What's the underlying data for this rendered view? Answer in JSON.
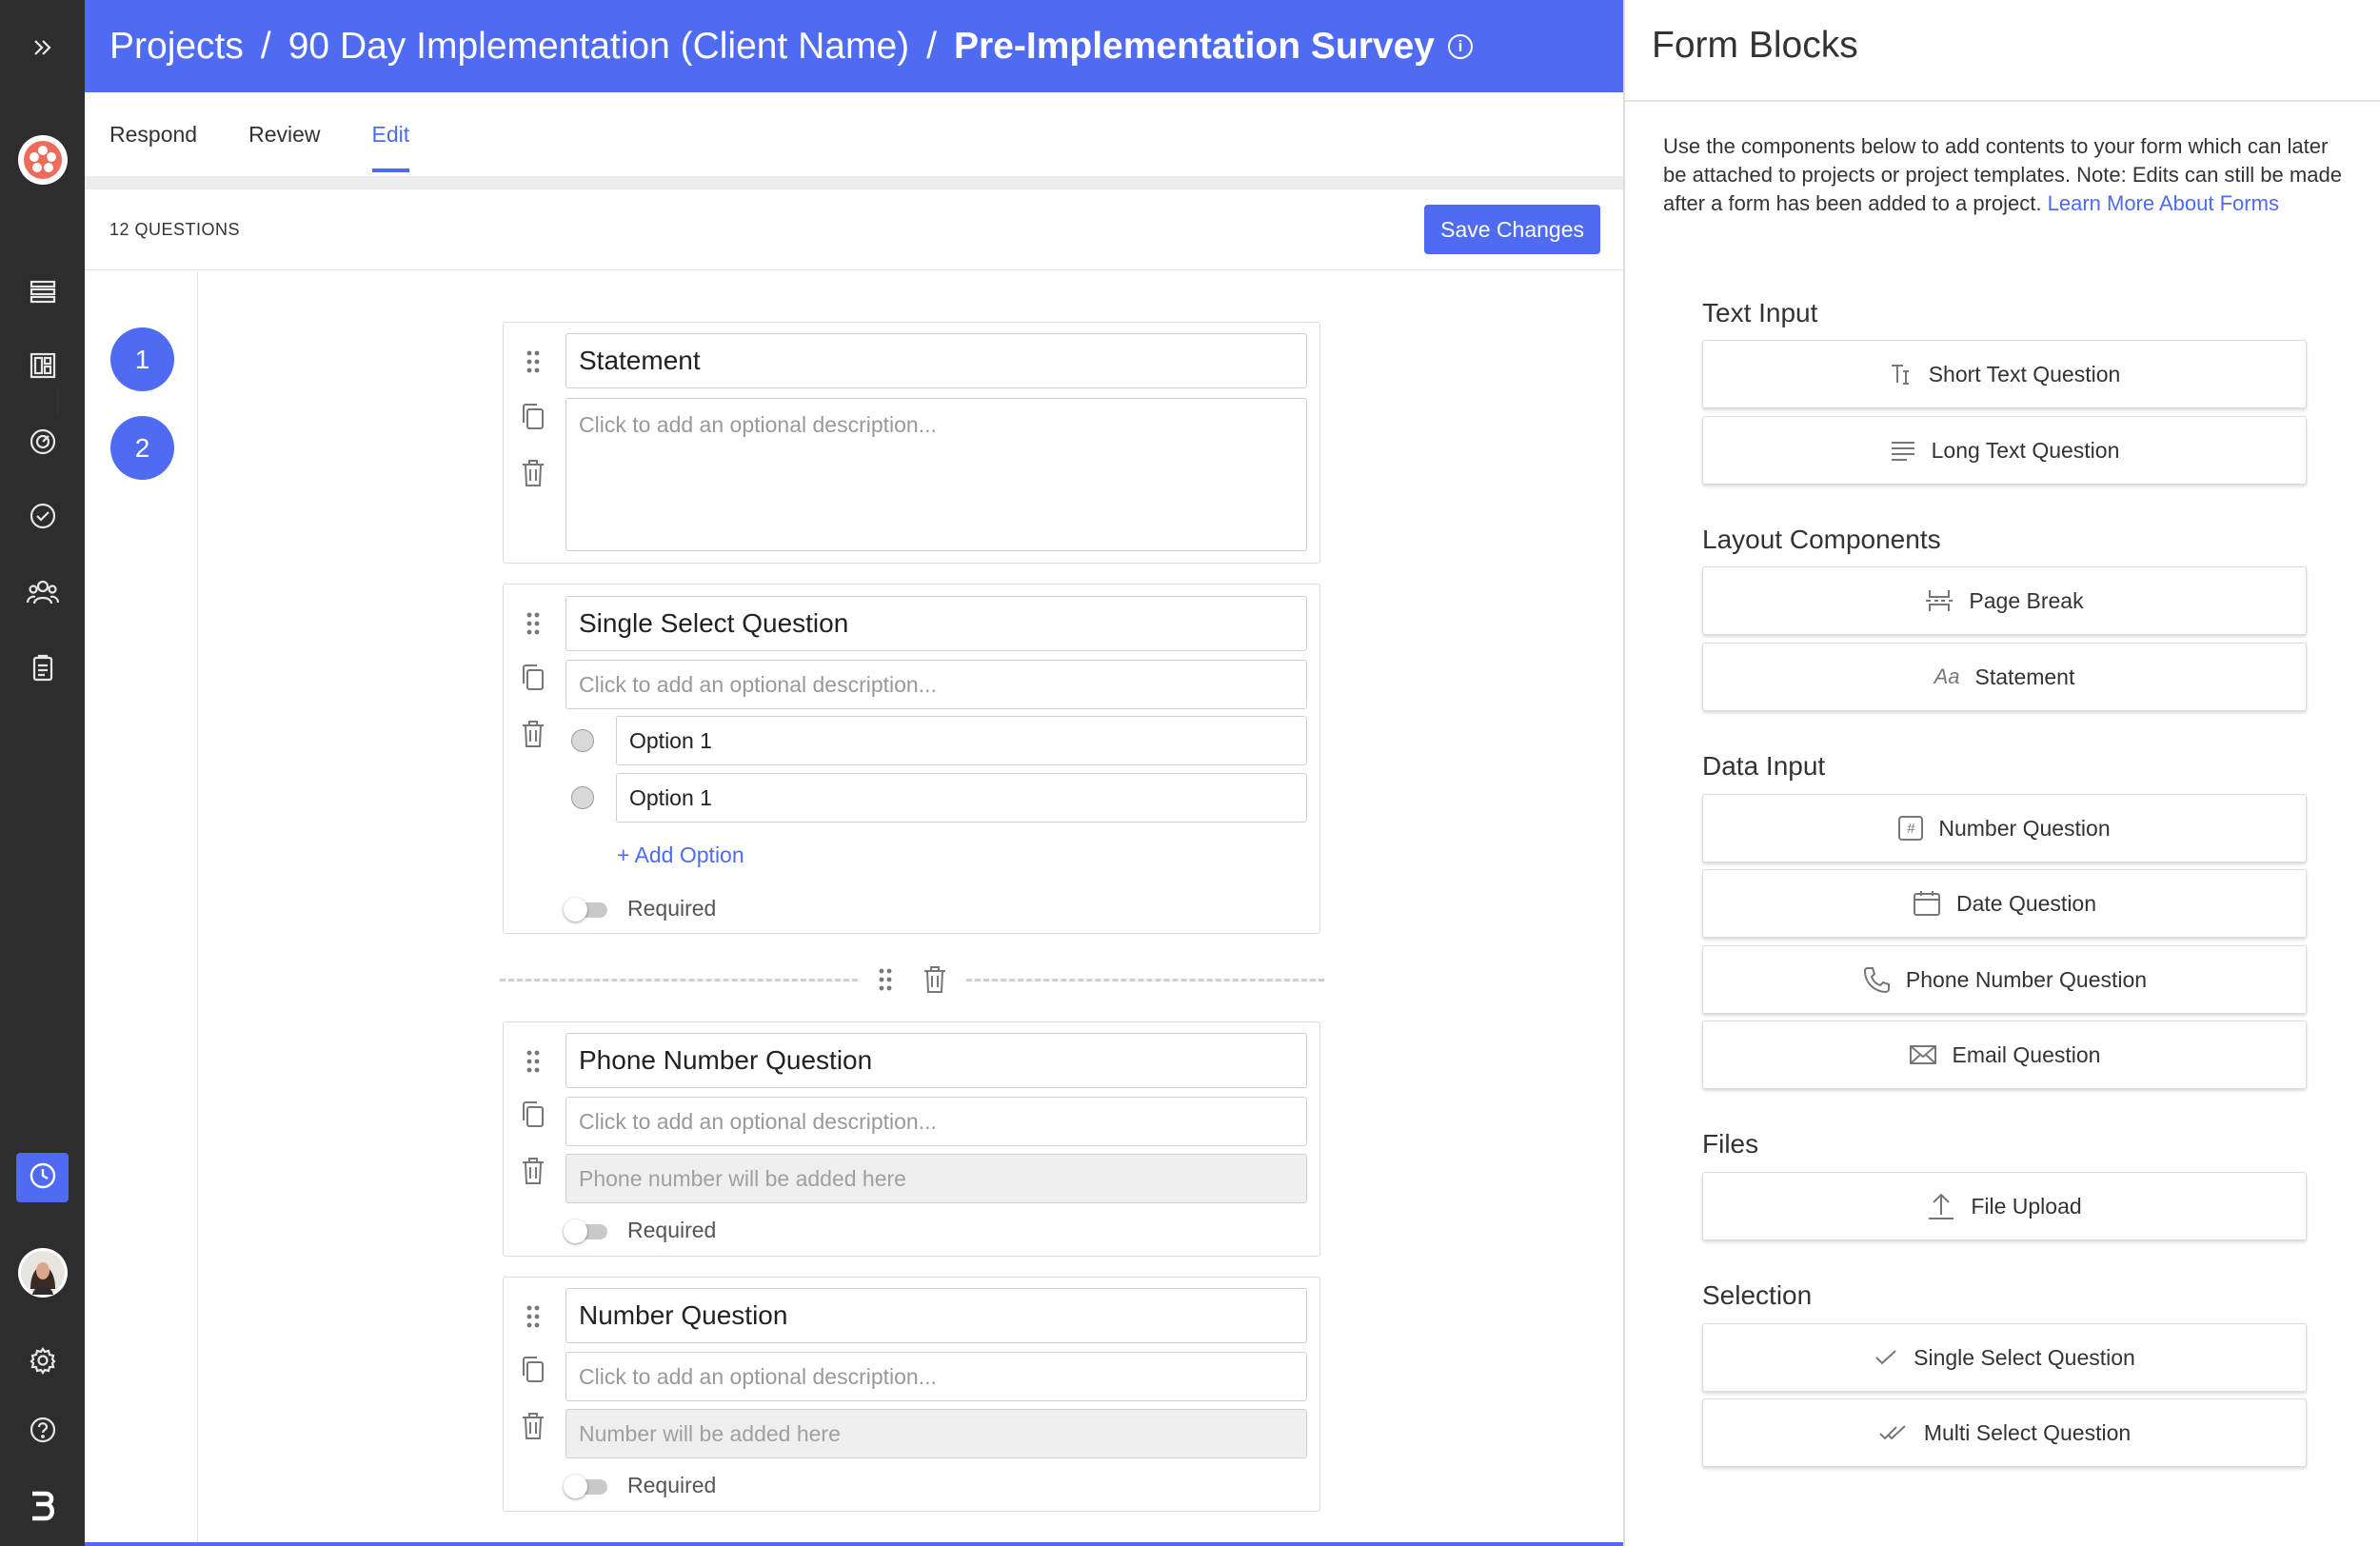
{
  "breadcrumb": {
    "root": "Projects",
    "project": "90 Day Implementation (Client Name)",
    "current": "Pre-Implementation Survey",
    "separator": "/",
    "info_glyph": "i"
  },
  "tabs": [
    {
      "label": "Respond",
      "active": false
    },
    {
      "label": "Review",
      "active": false
    },
    {
      "label": "Edit",
      "active": true
    }
  ],
  "toolbar": {
    "question_count": "12 QUESTIONS",
    "save_label": "Save Changes"
  },
  "steps": [
    "1",
    "2"
  ],
  "questions": {
    "q1": {
      "title": "Statement",
      "description_placeholder": "Click to add an optional description..."
    },
    "q2": {
      "title": "Single Select Question",
      "description_placeholder": "Click to add an optional description...",
      "options": [
        "Option 1",
        "Option 1"
      ],
      "add_option": "+ Add Option",
      "required_label": "Required"
    },
    "q3": {
      "title": "Phone Number Question",
      "description_placeholder": "Click to add an optional description...",
      "answer_placeholder": "Phone number will be added here",
      "required_label": "Required"
    },
    "q4": {
      "title": "Number Question",
      "description_placeholder": "Click to add an optional description...",
      "answer_placeholder": "Number will be added here",
      "required_label": "Required"
    }
  },
  "panel": {
    "title": "Form Blocks",
    "description": "Use the components below to add contents to your form which can later be attached to projects or project templates. Note: Edits can still be made after a form has been added to a project.",
    "learn_more": "Learn More About Forms",
    "sections": {
      "text_input": {
        "label": "Text Input",
        "items": [
          "Short Text Question",
          "Long Text Question"
        ]
      },
      "layout": {
        "label": "Layout Components",
        "items": [
          "Page Break",
          "Statement"
        ],
        "statement_icon": "Aa"
      },
      "data_input": {
        "label": "Data Input",
        "items": [
          "Number Question",
          "Date Question",
          "Phone Number Question",
          "Email Question"
        ],
        "number_icon": "#"
      },
      "files": {
        "label": "Files",
        "items": [
          "File Upload"
        ]
      },
      "selection": {
        "label": "Selection",
        "items": [
          "Single Select Question",
          "Multi Select Question"
        ]
      }
    }
  },
  "colors": {
    "accent": "#4e6bf2",
    "nav_bg": "#2d2d2d"
  }
}
